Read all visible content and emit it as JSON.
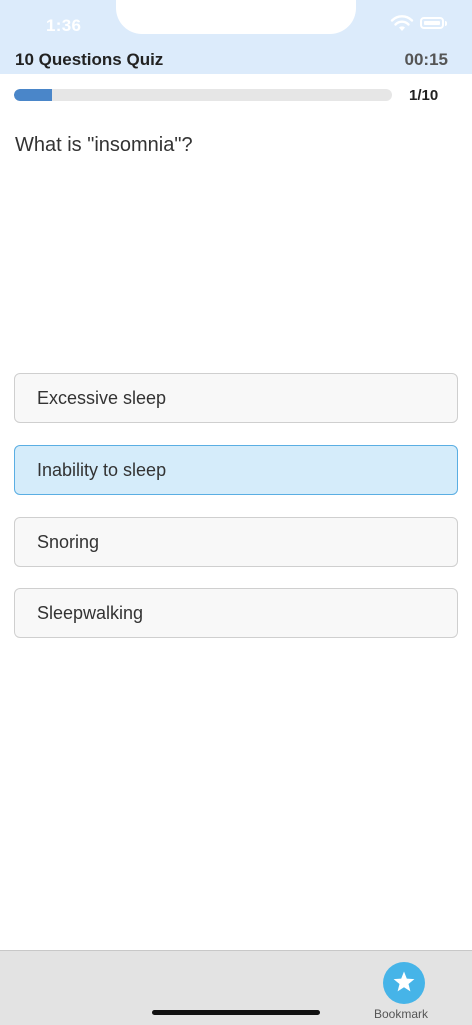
{
  "status_bar": {
    "time": "1:36"
  },
  "header": {
    "title": "10 Questions Quiz",
    "timer": "00:15"
  },
  "progress": {
    "current": 1,
    "total": 10,
    "label": "1/10",
    "fraction": 0.1
  },
  "question": {
    "text": "What is \"insomnia\"?"
  },
  "options": [
    {
      "label": "Excessive sleep",
      "selected": false
    },
    {
      "label": "Inability to sleep",
      "selected": true
    },
    {
      "label": "Snoring",
      "selected": false
    },
    {
      "label": "Sleepwalking",
      "selected": false
    }
  ],
  "tabbar": {
    "bookmark_label": "Bookmark",
    "bookmark_icon": "star-icon"
  },
  "colors": {
    "accent": "#4a86c9",
    "selected_bg": "#d5ecfa",
    "selected_border": "#5aaee3",
    "bookmark": "#46b4e8"
  }
}
